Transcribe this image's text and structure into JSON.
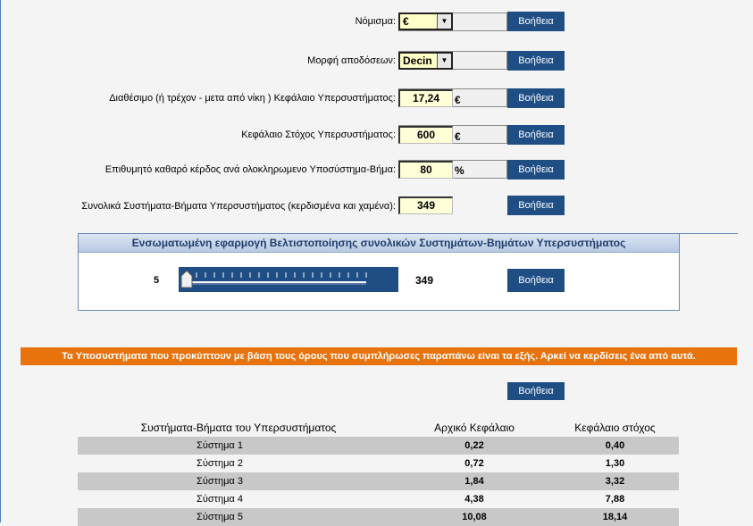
{
  "form": {
    "currency": {
      "label": "Νόμισμα:",
      "value": "€"
    },
    "odds_format": {
      "label": "Μορφή αποδόσεων:",
      "value": "Decin"
    },
    "available_capital": {
      "label": "Διαθέσιμο (ή τρέχον - μετα από νίκη ) Κεφάλαιο Υπερσυστήματος:",
      "value": "17,24",
      "unit": "€"
    },
    "target_capital": {
      "label": "Κεφάλαιο Στόχος Υπερσυστήματος:",
      "value": "600",
      "unit": "€"
    },
    "desired_profit": {
      "label": "Επιθυμητό καθαρό κέρδος ανά ολοκληρωμενο Υποσύστημα-Βήμα:",
      "value": "80",
      "unit": "%"
    },
    "total_systems": {
      "label": "Συνολικά Συστήματα-Βήματα Υπερσυστήματος (κερδισμένα και χαμένα):",
      "value": "349"
    },
    "help_label": "Βοήθεια"
  },
  "optimizer": {
    "title": "Ενσωματωμένη εφαρμογή Βελτιστοποίησης συνολικών Συστημάτων-Βημάτων Υπερσυστήματος",
    "min": "5",
    "max": "349",
    "slider_fraction": 0.0
  },
  "notice": "Τα Υποσυστήματα που προκύπτουν με βάση τους όρους που συμπλήρωσες παραπάνω είναι τα εξής. Αρκεί να κερδίσεις ένα από αυτά.",
  "table": {
    "headers": [
      "Συστήματα-Βήματα του Υπερσυστήματος",
      "Αρχικό Κεφάλαιο",
      "Κεφάλαιο στόχος"
    ],
    "rows": [
      [
        "Σύστημα 1",
        "0,22",
        "0,40"
      ],
      [
        "Σύστημα 2",
        "0,72",
        "1,30"
      ],
      [
        "Σύστημα 3",
        "1,84",
        "3,32"
      ],
      [
        "Σύστημα 4",
        "4,38",
        "7,88"
      ],
      [
        "Σύστημα 5",
        "10,08",
        "18,14"
      ]
    ]
  }
}
